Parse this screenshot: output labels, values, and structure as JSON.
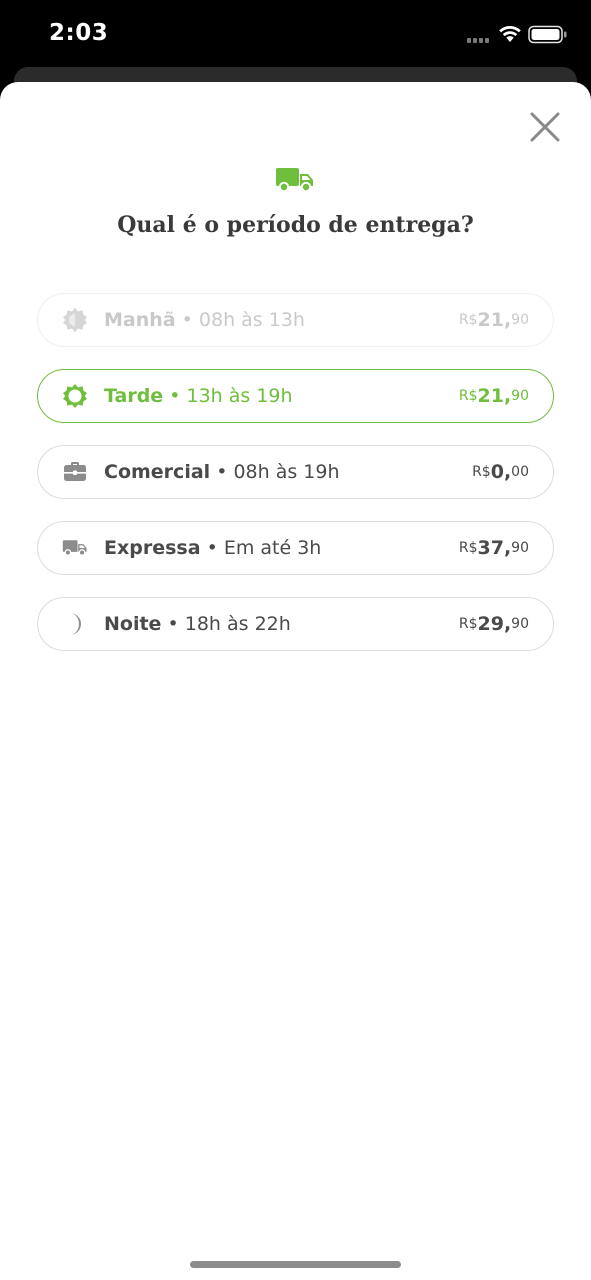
{
  "status_bar": {
    "time": "2:03",
    "icons": [
      "signal-icon",
      "wifi-icon",
      "battery-icon"
    ]
  },
  "sheet": {
    "title": "Qual é o período de entrega?",
    "header_icon": "truck-icon",
    "close_icon": "close-icon"
  },
  "options": [
    {
      "icon": "sun-dim-icon",
      "name": "Manhã",
      "separator": " • ",
      "period": "08h às 13h",
      "currency": "R$",
      "price_int": "21,",
      "price_dec": "90",
      "state": "disabled"
    },
    {
      "icon": "sun-icon",
      "name": "Tarde",
      "separator": " • ",
      "period": "13h às 19h",
      "currency": "R$",
      "price_int": "21,",
      "price_dec": "90",
      "state": "selected"
    },
    {
      "icon": "briefcase-icon",
      "name": "Comercial",
      "separator": " • ",
      "period": "08h às 19h",
      "currency": "R$",
      "price_int": "0,",
      "price_dec": "00",
      "state": "default"
    },
    {
      "icon": "truck-icon",
      "name": "Expressa",
      "separator": " • ",
      "period": "Em até 3h",
      "currency": "R$",
      "price_int": "37,",
      "price_dec": "90",
      "state": "default"
    },
    {
      "icon": "moon-icon",
      "name": "Noite",
      "separator": " • ",
      "period": "18h às 22h",
      "currency": "R$",
      "price_int": "29,",
      "price_dec": "90",
      "state": "default"
    }
  ],
  "colors": {
    "accent": "#6fbe3c",
    "text": "#4a4a4a",
    "disabled": "#c9c9c9",
    "border": "#dddddd"
  }
}
